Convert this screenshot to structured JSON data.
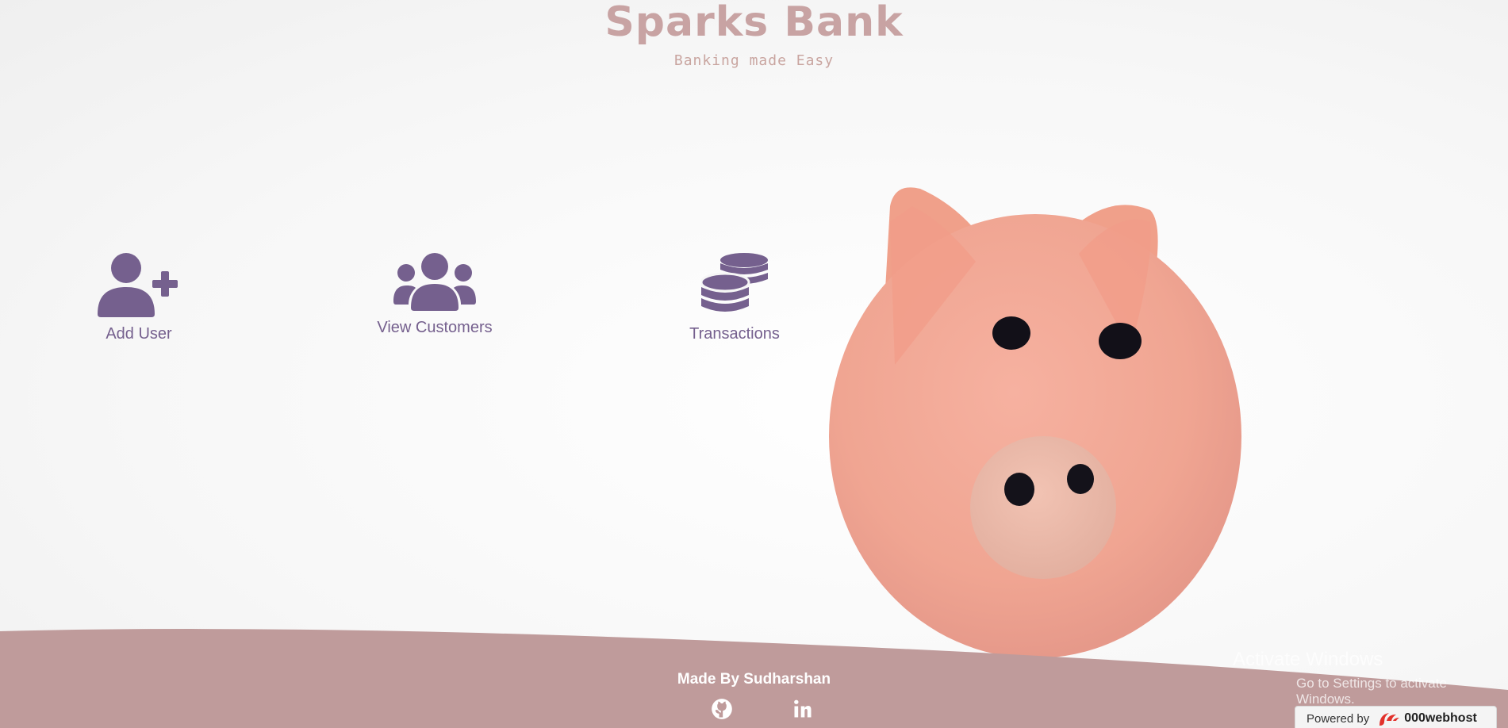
{
  "header": {
    "title": "Sparks Bank",
    "subtitle": "Banking made Easy"
  },
  "nav": {
    "add_user": "Add User",
    "view_customers": "View Customers",
    "transactions": "Transactions"
  },
  "footer": {
    "credit": "Made By Sudharshan"
  },
  "watermark": {
    "title": "Activate Windows",
    "subtitle": "Go to Settings to activate Windows."
  },
  "powered_by": {
    "label": "Powered by",
    "brand": "000webhost"
  },
  "icons": {
    "add_user": "user-plus-icon",
    "view_customers": "users-icon",
    "transactions": "coins-icon",
    "github": "github-icon",
    "linkedin": "linkedin-icon"
  },
  "colors": {
    "accent": "#75608e",
    "brand": "#c8a3a3",
    "footer": "#bf9b9b"
  }
}
